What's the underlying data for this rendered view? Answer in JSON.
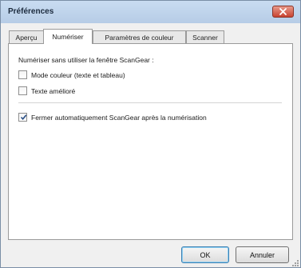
{
  "window": {
    "title": "Préférences"
  },
  "tabs": [
    {
      "label": "Aperçu",
      "active": false
    },
    {
      "label": "Numériser",
      "active": true
    },
    {
      "label": "Paramètres de couleur",
      "active": false
    },
    {
      "label": "Scanner",
      "active": false
    }
  ],
  "panel": {
    "section_label": "Numériser sans utiliser la fenêtre ScanGear :",
    "options": [
      {
        "label": "Mode couleur (texte et tableau)",
        "checked": false
      },
      {
        "label": "Texte amélioré",
        "checked": false
      },
      {
        "label": "Fermer automatiquement ScanGear après la numérisation",
        "checked": true
      }
    ]
  },
  "buttons": {
    "ok": "OK",
    "cancel": "Annuler"
  },
  "colors": {
    "close_button": "#c84330",
    "accent_border": "#3c7fb1",
    "check": "#2a4f86"
  }
}
